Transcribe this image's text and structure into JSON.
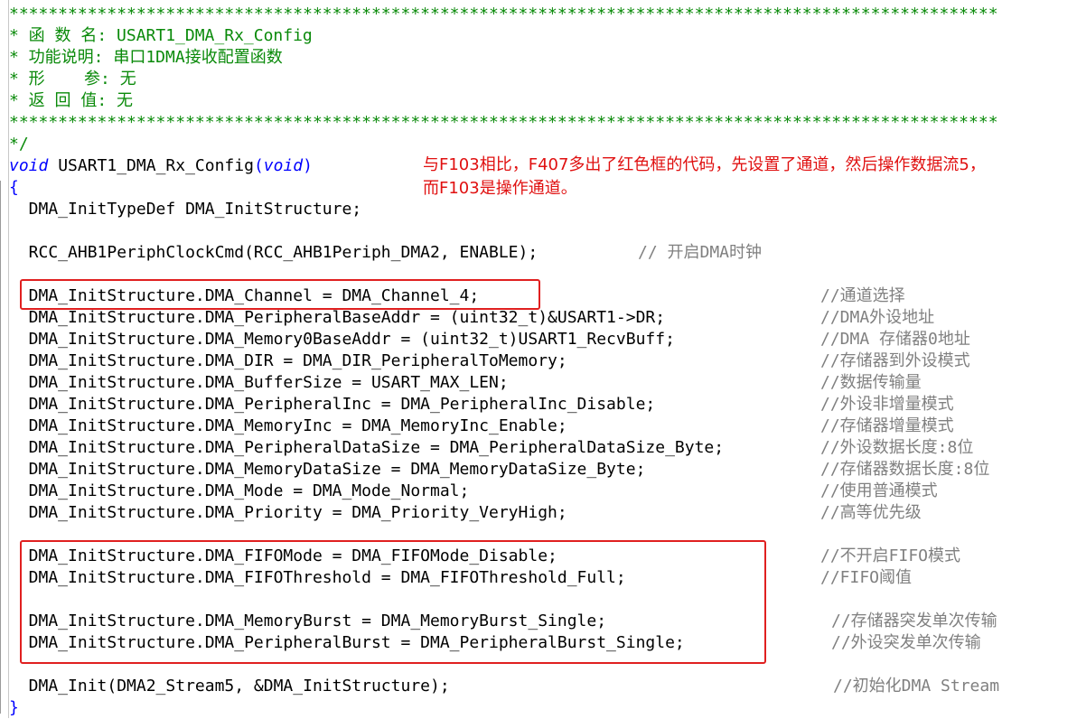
{
  "header_comment": {
    "border": "*****************************************************************************************************",
    "lines": [
      "* 函 数 名: USART1_DMA_Rx_Config",
      "* 功能说明: 串口1DMA接收配置函数",
      "* 形    参: 无",
      "* 返 回 值: 无"
    ],
    "close": "*/"
  },
  "signature": {
    "ret": "void",
    "name": "USART1_DMA_Rx_Config",
    "param": "void"
  },
  "annotation": "与F103相比，F407多出了红色框的代码，先设置了通道，然后操作数据流5，\n而F103是操作通道。",
  "open_brace": "{",
  "close_brace": "}",
  "decl": "  DMA_InitTypeDef DMA_InitStructure;",
  "rcc": {
    "code": "  RCC_AHB1PeriphClockCmd(RCC_AHB1Periph_DMA2, ENABLE);",
    "comment": "// 开启DMA时钟"
  },
  "assigns": [
    {
      "code": "  DMA_InitStructure.DMA_Channel = DMA_Channel_4;",
      "comment": "//通道选择"
    },
    {
      "code": "  DMA_InitStructure.DMA_PeripheralBaseAddr = (uint32_t)&USART1->DR;",
      "comment": "//DMA外设地址"
    },
    {
      "code": "  DMA_InitStructure.DMA_Memory0BaseAddr = (uint32_t)USART1_RecvBuff;",
      "comment": "//DMA 存储器0地址"
    },
    {
      "code": "  DMA_InitStructure.DMA_DIR = DMA_DIR_PeripheralToMemory;",
      "comment": "//存储器到外设模式"
    },
    {
      "code": "  DMA_InitStructure.DMA_BufferSize = USART_MAX_LEN;",
      "comment": "//数据传输量"
    },
    {
      "code": "  DMA_InitStructure.DMA_PeripheralInc = DMA_PeripheralInc_Disable;",
      "comment": "//外设非增量模式"
    },
    {
      "code": "  DMA_InitStructure.DMA_MemoryInc = DMA_MemoryInc_Enable;",
      "comment": "//存储器增量模式"
    },
    {
      "code": "  DMA_InitStructure.DMA_PeripheralDataSize = DMA_PeripheralDataSize_Byte;",
      "comment": "//外设数据长度:8位"
    },
    {
      "code": "  DMA_InitStructure.DMA_MemoryDataSize = DMA_MemoryDataSize_Byte;",
      "comment": "//存储器数据长度:8位"
    },
    {
      "code": "  DMA_InitStructure.DMA_Mode = DMA_Mode_Normal;",
      "comment": "//使用普通模式"
    },
    {
      "code": "  DMA_InitStructure.DMA_Priority = DMA_Priority_VeryHigh;",
      "comment": "//高等优先级"
    },
    {
      "code": "  DMA_InitStructure.DMA_FIFOMode = DMA_FIFOMode_Disable;",
      "comment": "//不开启FIFO模式"
    },
    {
      "code": "  DMA_InitStructure.DMA_FIFOThreshold = DMA_FIFOThreshold_Full;",
      "comment": "//FIFO阈值"
    },
    {
      "code": "  DMA_InitStructure.DMA_MemoryBurst = DMA_MemoryBurst_Single;",
      "comment": "//存储器突发单次传输"
    },
    {
      "code": "  DMA_InitStructure.DMA_PeripheralBurst = DMA_PeripheralBurst_Single;",
      "comment": "//外设突发单次传输"
    }
  ],
  "init": {
    "code": "  DMA_Init(DMA2_Stream5, &DMA_InitStructure);",
    "comment": "//初始化DMA Stream"
  },
  "colors": {
    "comment": "#0a8a0a",
    "keyword": "#0000ff",
    "highlight_box": "#e02020",
    "annotation": "#e01010"
  }
}
